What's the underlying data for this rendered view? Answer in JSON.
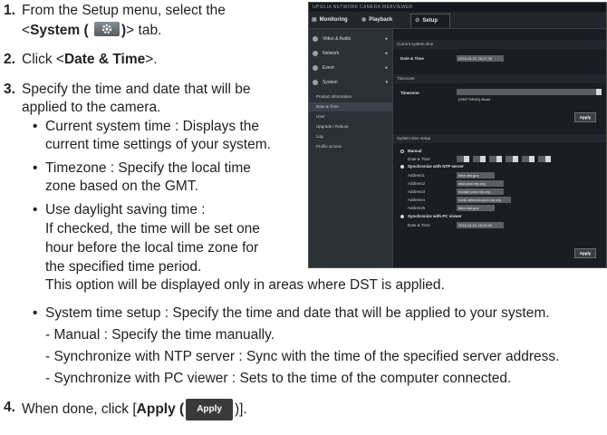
{
  "steps": {
    "s1": {
      "num": "1.",
      "line1": "From the Setup menu, select the",
      "lt": "<",
      "system": "System (",
      "close": ")",
      "tab_text": "> tab."
    },
    "s2": {
      "num": "2.",
      "pre": "Click <",
      "bold": "Date & Time",
      "post": ">."
    },
    "s3": {
      "num": "3.",
      "line1": "Specify the time and date that will be",
      "line2": "applied to the camera."
    },
    "bullets": [
      {
        "line1": "Current system time : Displays the",
        "line2": "current time settings of your system."
      },
      {
        "line1": "Timezone : Specify the local time",
        "line2": "zone based on the GMT."
      },
      {
        "line1": "Use daylight saving time :",
        "line2": "If checked, the time will be set one",
        "line3": "hour before the local time zone for",
        "line4": "the specified time period."
      }
    ],
    "dst_note": "This option will be displayed only in areas where DST is applied.",
    "sys_bullet": "System time setup : Specify the time and date that will be applied to your system.",
    "dashes": [
      "- Manual : Specify the time manually.",
      "- Synchronize with NTP server : Sync with the time of the specified server address.",
      "- Synchronize with PC viewer : Sets to the time of the computer connected."
    ],
    "s4": {
      "num": "4.",
      "pre": "When done, click [",
      "bold": "Apply (",
      "close": ")].",
      "btn": "Apply"
    }
  },
  "screenshot": {
    "title": "UPSILIA NETWORK CAMERA WEBVIEWER",
    "tabs": {
      "monitoring": "Monitoring",
      "playback": "Playback",
      "setup": "Setup"
    },
    "sidebar": {
      "video_audio": "Video & Audio",
      "network": "Network",
      "event": "Event",
      "system": "System",
      "sub": [
        "Product information",
        "Date & Time",
        "User",
        "Upgrade / Reboot",
        "Log",
        "Profile access"
      ]
    },
    "sections": {
      "current": "Current system time",
      "timezone": "Timezone",
      "setup": "System time setup"
    },
    "labels": {
      "date_time": "Date & Time",
      "timezone": "Timezone",
      "manual": "Manual",
      "ntp": "Synchronize with NTP server",
      "address1": "Address1",
      "address2": "Address2",
      "address3": "Address3",
      "address4": "Address4",
      "address5": "Address5",
      "pc": "Synchronize with PC viewer",
      "apply": "Apply"
    },
    "values": {
      "current_time": "2016-01-01 16:27:30",
      "timezone": "(GMT+09:00) Seoul",
      "address1": "time.nist.gov",
      "address2": "asia.pool.ntp.org",
      "address3": "europe.pool.ntp.org",
      "address4": "north-america.pool.ntp.org",
      "address5": "time.nist.gov",
      "pc_time": "2016-01-01 16:25:00"
    }
  }
}
